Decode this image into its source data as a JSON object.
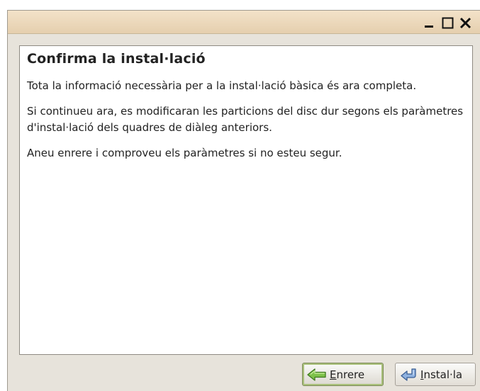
{
  "window": {
    "controls": {
      "minimize": "minimize-icon",
      "maximize": "maximize-icon",
      "close": "close-icon"
    }
  },
  "content": {
    "heading": "Confirma la instal·lació",
    "paragraphs": [
      "Tota la informació necessària per a la instal·lació bàsica és ara completa.",
      "Si continueu ara, es modificaran les particions del disc dur segons els paràmetres d'instal·lació dels quadres de diàleg anteriors.",
      "Aneu enrere i comproveu els paràmetres si no esteu segur."
    ]
  },
  "buttons": {
    "back": {
      "mnemonic": "E",
      "rest": "nrere",
      "icon": "back-arrow-icon"
    },
    "install": {
      "prefix": "",
      "mnemonic": "I",
      "rest": "nstal·la",
      "icon": "install-icon"
    }
  },
  "colors": {
    "titlebar": "#ecd8bb",
    "window_bg": "#e7e3db",
    "focus_ring": "#a9c07a"
  }
}
